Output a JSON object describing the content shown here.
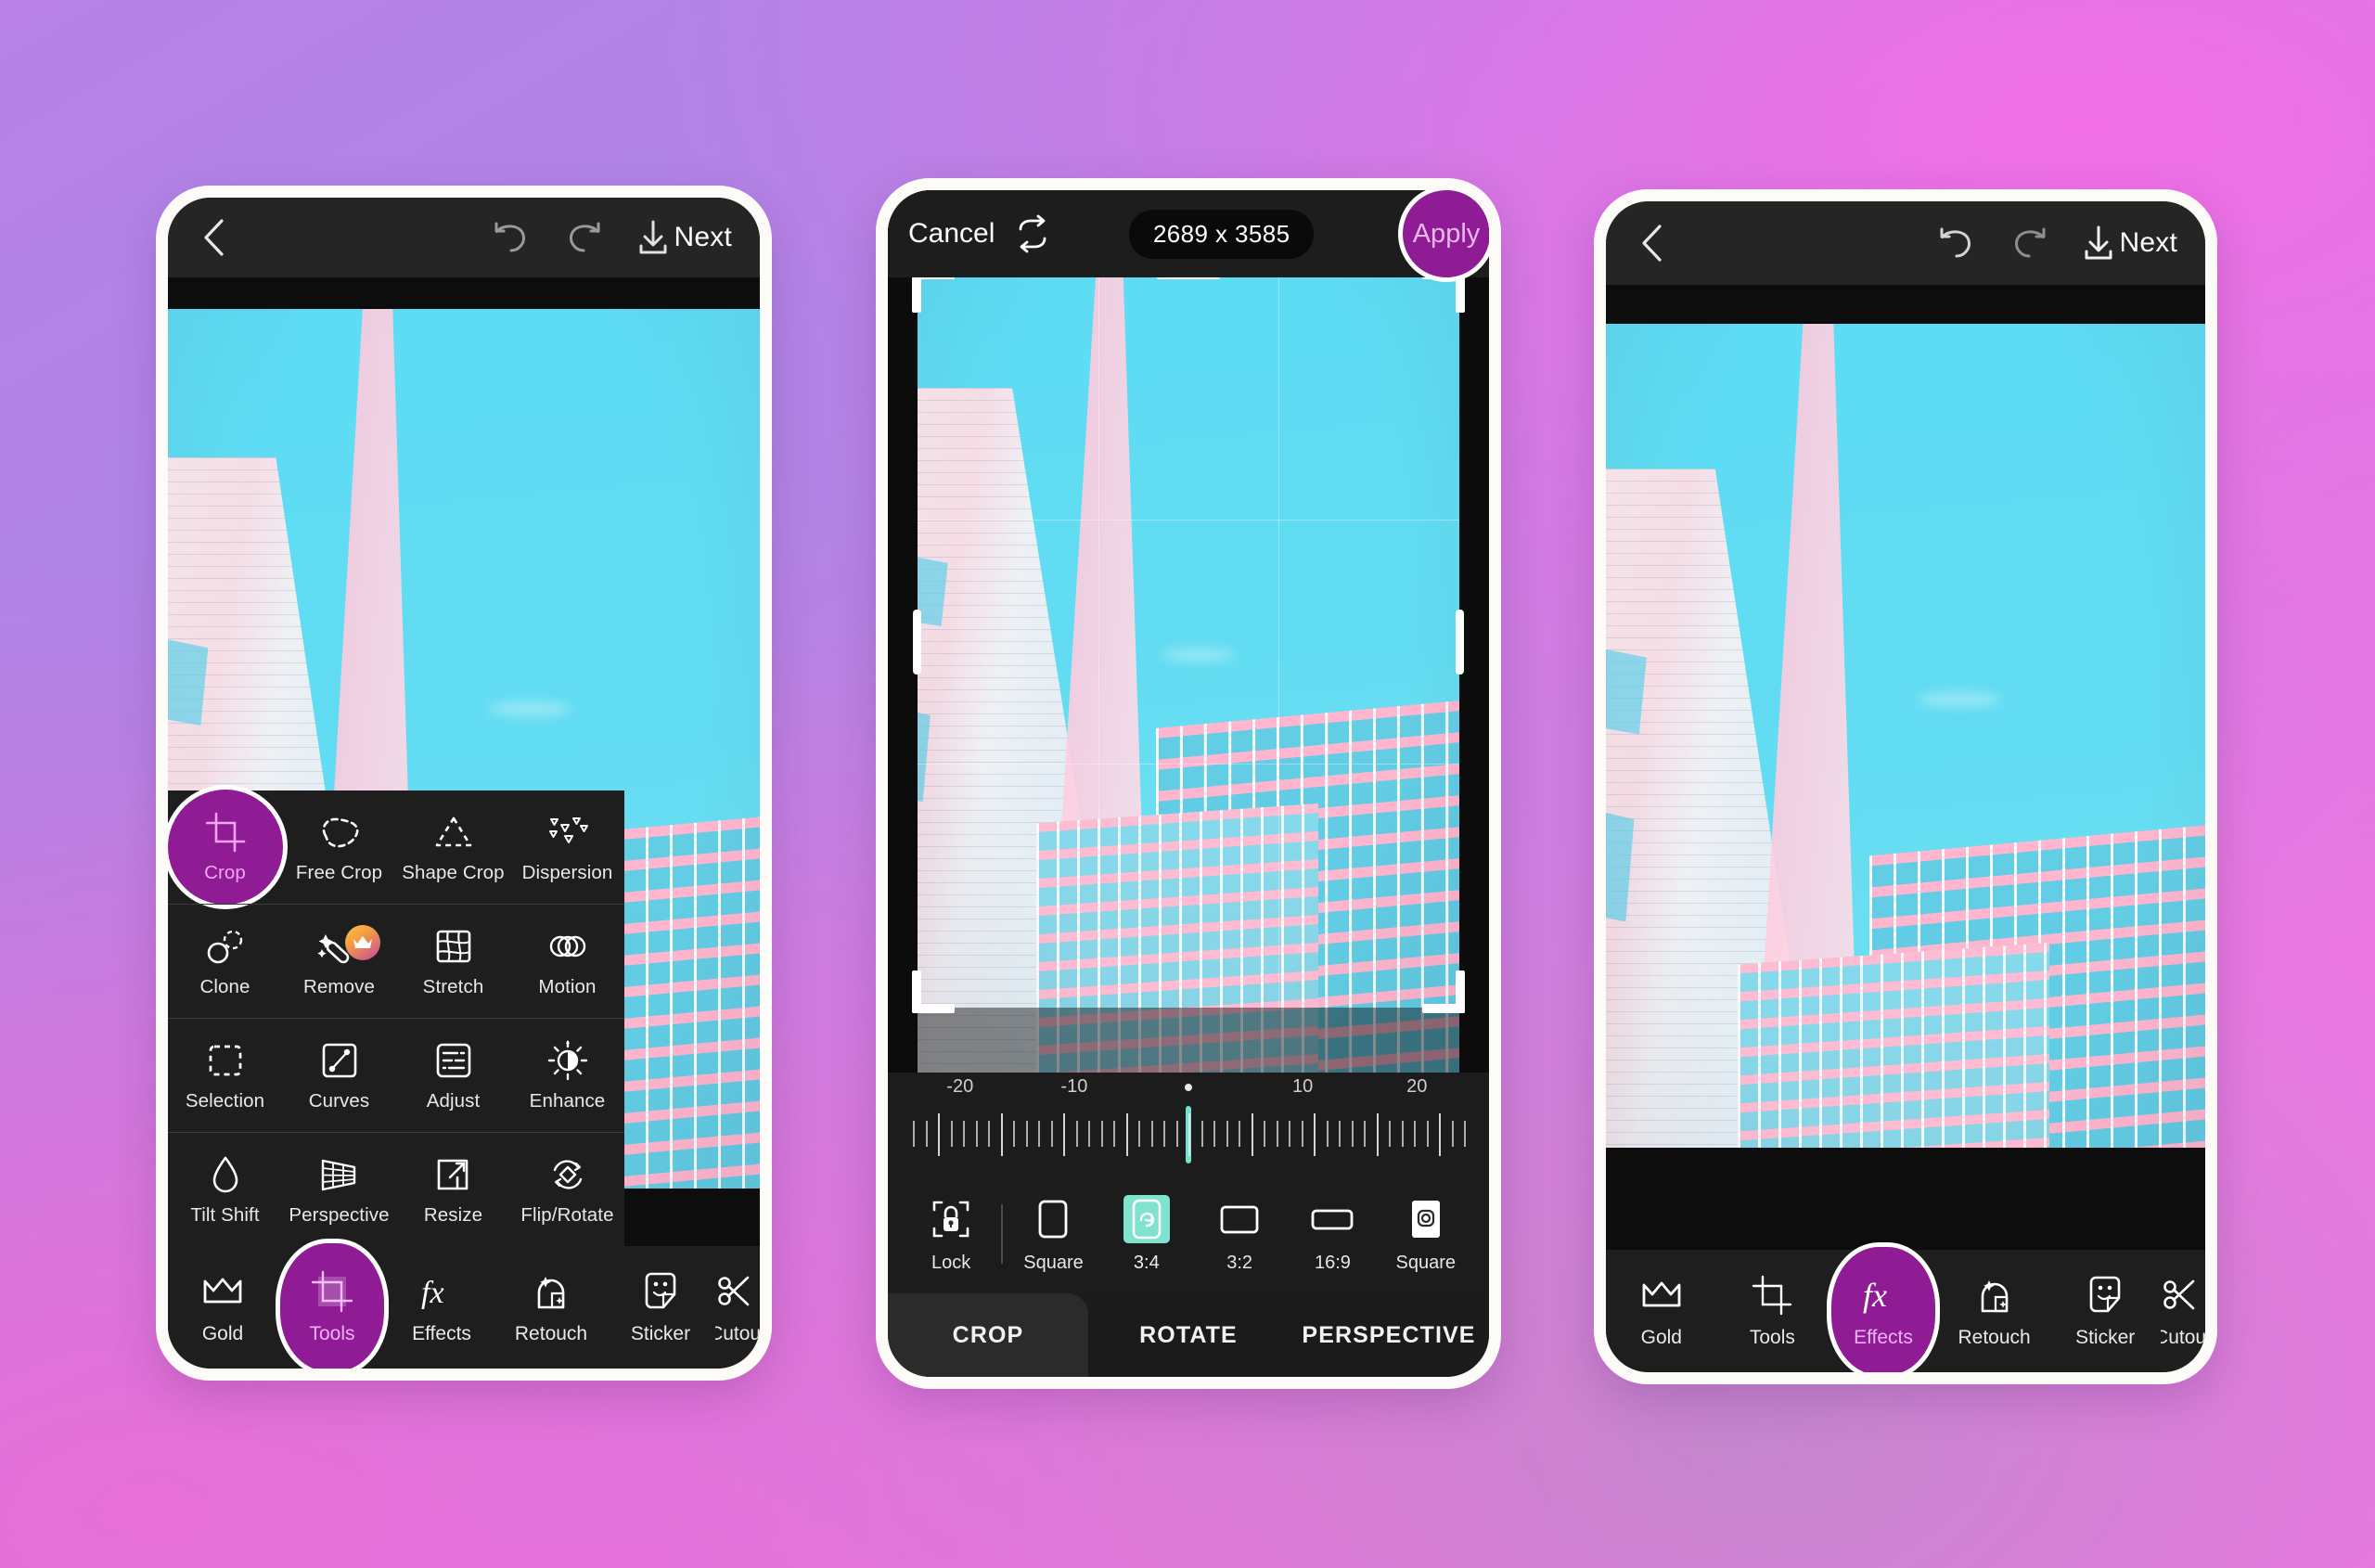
{
  "background": {
    "gradient_from": "#b882e8",
    "gradient_to": "#f472e6"
  },
  "theme": {
    "accent_purple": "#8f1c94",
    "accent_pink_text": "#f2a5f5",
    "accent_teal": "#7fe3cf",
    "panel_bg": "#1e1e1e",
    "screen_bg": "#121212"
  },
  "photo": {
    "description": "Vaporwave architecture photo: cyan sky, white-pink triangular skyscraper at left, pink and teal glass apartment tower at right",
    "sky_color": "#5ddcf4",
    "building_pink": "#ffd2e2",
    "glass_teal": "#5fd2e8"
  },
  "phone1": {
    "topbar": {
      "back_icon": "chevron-left-icon",
      "undo_icon": "undo-icon",
      "redo_icon": "redo-icon",
      "save_icon": "download-icon",
      "next_label": "Next"
    },
    "tools_panel": {
      "rows": [
        [
          {
            "label": "Crop",
            "icon": "crop-icon",
            "active": true,
            "premium": false
          },
          {
            "label": "Free Crop",
            "icon": "free-crop-icon",
            "active": false,
            "premium": false
          },
          {
            "label": "Shape Crop",
            "icon": "shape-crop-icon",
            "active": false,
            "premium": false
          },
          {
            "label": "Dispersion",
            "icon": "dispersion-icon",
            "active": false,
            "premium": false
          }
        ],
        [
          {
            "label": "Clone",
            "icon": "clone-icon",
            "active": false,
            "premium": false
          },
          {
            "label": "Remove",
            "icon": "remove-icon",
            "active": false,
            "premium": true
          },
          {
            "label": "Stretch",
            "icon": "stretch-icon",
            "active": false,
            "premium": false
          },
          {
            "label": "Motion",
            "icon": "motion-icon",
            "active": false,
            "premium": false
          }
        ],
        [
          {
            "label": "Selection",
            "icon": "selection-icon",
            "active": false,
            "premium": false
          },
          {
            "label": "Curves",
            "icon": "curves-icon",
            "active": false,
            "premium": false
          },
          {
            "label": "Adjust",
            "icon": "adjust-icon",
            "active": false,
            "premium": false
          },
          {
            "label": "Enhance",
            "icon": "enhance-icon",
            "active": false,
            "premium": false
          }
        ],
        [
          {
            "label": "Tilt Shift",
            "icon": "tilt-shift-icon",
            "active": false,
            "premium": false
          },
          {
            "label": "Perspective",
            "icon": "perspective-icon",
            "active": false,
            "premium": false
          },
          {
            "label": "Resize",
            "icon": "resize-icon",
            "active": false,
            "premium": false
          },
          {
            "label": "Flip/Rotate",
            "icon": "flip-rotate-icon",
            "active": false,
            "premium": false
          }
        ]
      ]
    },
    "bottomnav": [
      {
        "label": "Gold",
        "icon": "crown-icon",
        "active": false
      },
      {
        "label": "Tools",
        "icon": "crop-icon",
        "active": true
      },
      {
        "label": "Effects",
        "icon": "fx-icon",
        "active": false
      },
      {
        "label": "Retouch",
        "icon": "retouch-face-icon",
        "active": false
      },
      {
        "label": "Sticker",
        "icon": "sticker-icon",
        "active": false
      },
      {
        "label": "Cutout",
        "icon": "scissors-icon",
        "active": false
      }
    ]
  },
  "phone2": {
    "topbar": {
      "cancel_label": "Cancel",
      "swap_icon": "swap-aspect-icon",
      "size_label": "2689 x 3585",
      "apply_label": "Apply"
    },
    "ruler": {
      "tick_labels": [
        "-20",
        "-10",
        "10",
        "20"
      ],
      "value": 0,
      "min": -45,
      "max": 45
    },
    "ratio_bar": [
      {
        "label": "Lock",
        "icon": "lock-icon",
        "selected": false
      },
      {
        "label": "Square",
        "icon": "rect-portrait-icon",
        "selected": false
      },
      {
        "label": "3:4",
        "icon": "rotate-portrait-icon",
        "selected": true
      },
      {
        "label": "3:2",
        "icon": "rect-landscape-icon",
        "selected": false
      },
      {
        "label": "16:9",
        "icon": "rect-wide-icon",
        "selected": false
      },
      {
        "label": "Square",
        "icon": "instagram-icon",
        "selected": false
      }
    ],
    "tabs": [
      {
        "label": "CROP",
        "active": true
      },
      {
        "label": "ROTATE",
        "active": false
      },
      {
        "label": "PERSPECTIVE",
        "active": false
      }
    ]
  },
  "phone3": {
    "topbar": {
      "back_icon": "chevron-left-icon",
      "undo_icon": "undo-icon",
      "redo_icon": "redo-icon",
      "save_icon": "download-icon",
      "next_label": "Next"
    },
    "bottomnav": [
      {
        "label": "Gold",
        "icon": "crown-icon",
        "active": false
      },
      {
        "label": "Tools",
        "icon": "crop-icon",
        "active": false
      },
      {
        "label": "Effects",
        "icon": "fx-icon",
        "active": true
      },
      {
        "label": "Retouch",
        "icon": "retouch-face-icon",
        "active": false
      },
      {
        "label": "Sticker",
        "icon": "sticker-icon",
        "active": false
      },
      {
        "label": "Cutout",
        "icon": "scissors-icon",
        "active": false
      }
    ]
  }
}
